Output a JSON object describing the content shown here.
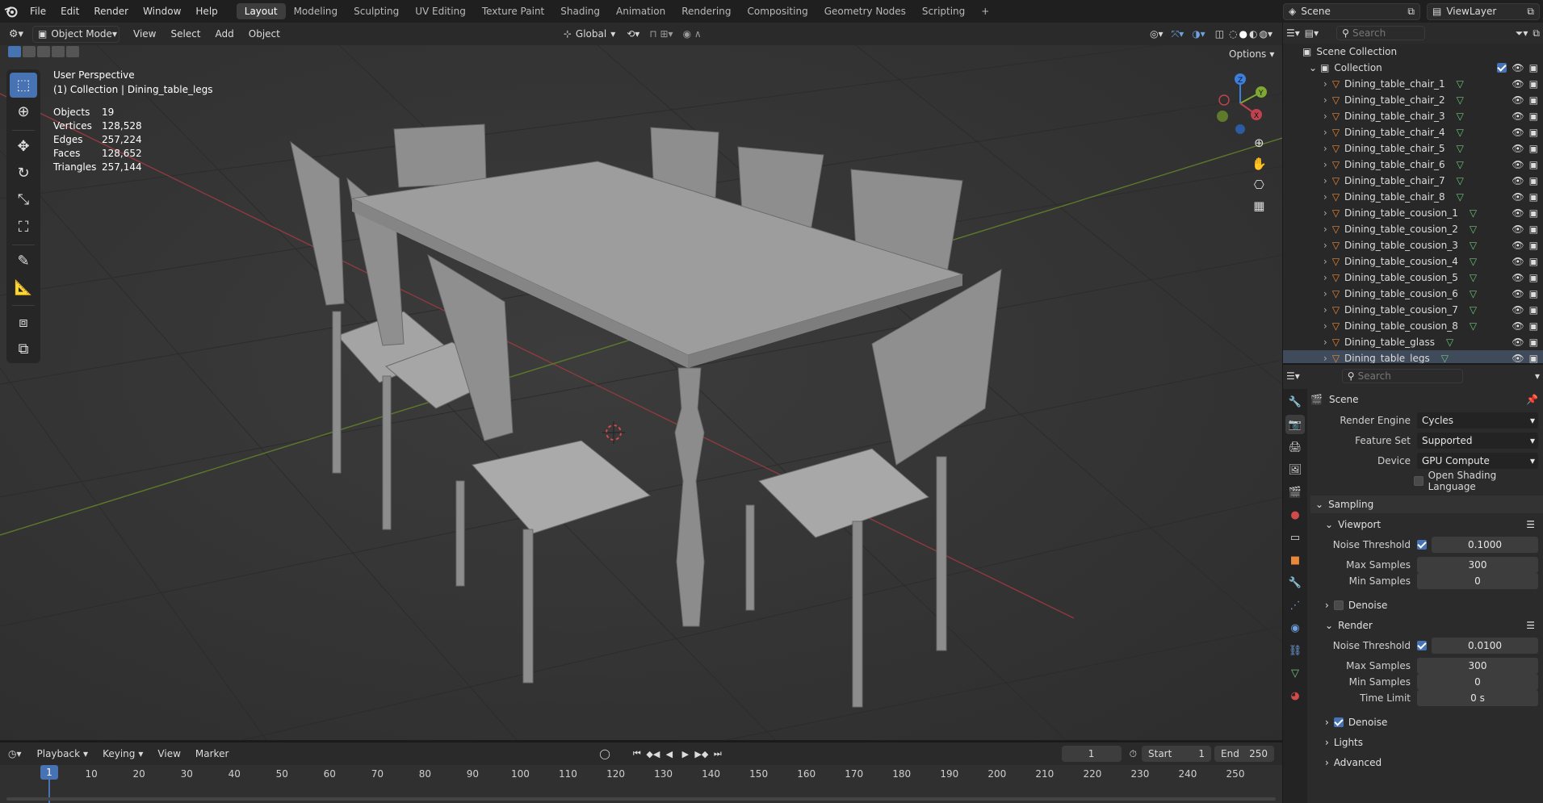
{
  "topbar": {
    "menus": [
      "File",
      "Edit",
      "Render",
      "Window",
      "Help"
    ],
    "workspaces": [
      "Layout",
      "Modeling",
      "Sculpting",
      "UV Editing",
      "Texture Paint",
      "Shading",
      "Animation",
      "Rendering",
      "Compositing",
      "Geometry Nodes",
      "Scripting"
    ],
    "active_workspace": "Layout",
    "add_tab": "+",
    "scene": "Scene",
    "view_layer": "ViewLayer"
  },
  "viewport_header": {
    "mode": "Object Mode",
    "menus": [
      "View",
      "Select",
      "Add",
      "Object"
    ],
    "transform_orientation": "Global",
    "options": "Options"
  },
  "overlay": {
    "perspective": "User Perspective",
    "context": "(1) Collection | Dining_table_legs",
    "stats": [
      {
        "label": "Objects",
        "value": "19"
      },
      {
        "label": "Vertices",
        "value": "128,528"
      },
      {
        "label": "Edges",
        "value": "257,224"
      },
      {
        "label": "Faces",
        "value": "128,652"
      },
      {
        "label": "Triangles",
        "value": "257,144"
      }
    ]
  },
  "gizmo": {
    "x": "X",
    "y": "Y",
    "z": "Z"
  },
  "outliner": {
    "search_placeholder": "Search",
    "root": "Scene Collection",
    "collection": "Collection",
    "items": [
      "Dining_table_chair_1",
      "Dining_table_chair_2",
      "Dining_table_chair_3",
      "Dining_table_chair_4",
      "Dining_table_chair_5",
      "Dining_table_chair_6",
      "Dining_table_chair_7",
      "Dining_table_chair_8",
      "Dining_table_cousion_1",
      "Dining_table_cousion_2",
      "Dining_table_cousion_3",
      "Dining_table_cousion_4",
      "Dining_table_cousion_5",
      "Dining_table_cousion_6",
      "Dining_table_cousion_7",
      "Dining_table_cousion_8",
      "Dining_table_glass",
      "Dining_table_legs"
    ],
    "selected_item": "Dining_table_legs"
  },
  "properties": {
    "search_placeholder": "Search",
    "context": "Scene",
    "render_engine_label": "Render Engine",
    "render_engine": "Cycles",
    "feature_set_label": "Feature Set",
    "feature_set": "Supported",
    "device_label": "Device",
    "device": "GPU Compute",
    "osl_label": "Open Shading Language",
    "sampling_label": "Sampling",
    "viewport_label": "Viewport",
    "noise_threshold_label": "Noise Threshold",
    "max_samples_label": "Max Samples",
    "min_samples_label": "Min Samples",
    "viewport_noise_threshold": "0.1000",
    "viewport_max_samples": "300",
    "viewport_min_samples": "0",
    "denoise_label": "Denoise",
    "render_label": "Render",
    "render_noise_threshold": "0.0100",
    "render_max_samples": "300",
    "render_min_samples": "0",
    "time_limit_label": "Time Limit",
    "time_limit": "0 s",
    "lights_label": "Lights",
    "advanced_label": "Advanced"
  },
  "timeline": {
    "menus": [
      "Playback",
      "Keying",
      "View",
      "Marker"
    ],
    "current_frame": "1",
    "start_label": "Start",
    "start": "1",
    "end_label": "End",
    "end": "250",
    "frame_ticks": [
      "1",
      "10",
      "20",
      "30",
      "40",
      "50",
      "60",
      "70",
      "80",
      "90",
      "100",
      "110",
      "120",
      "130",
      "140",
      "150",
      "160",
      "170",
      "180",
      "190",
      "200",
      "210",
      "220",
      "230",
      "240",
      "250"
    ]
  },
  "colors": {
    "accent": "#4772b3",
    "x_axis": "#c0424e",
    "y_axis": "#7fa832",
    "z_axis": "#3d7fe0",
    "object_orange": "#e8893a",
    "mesh_green": "#6fc47f"
  }
}
